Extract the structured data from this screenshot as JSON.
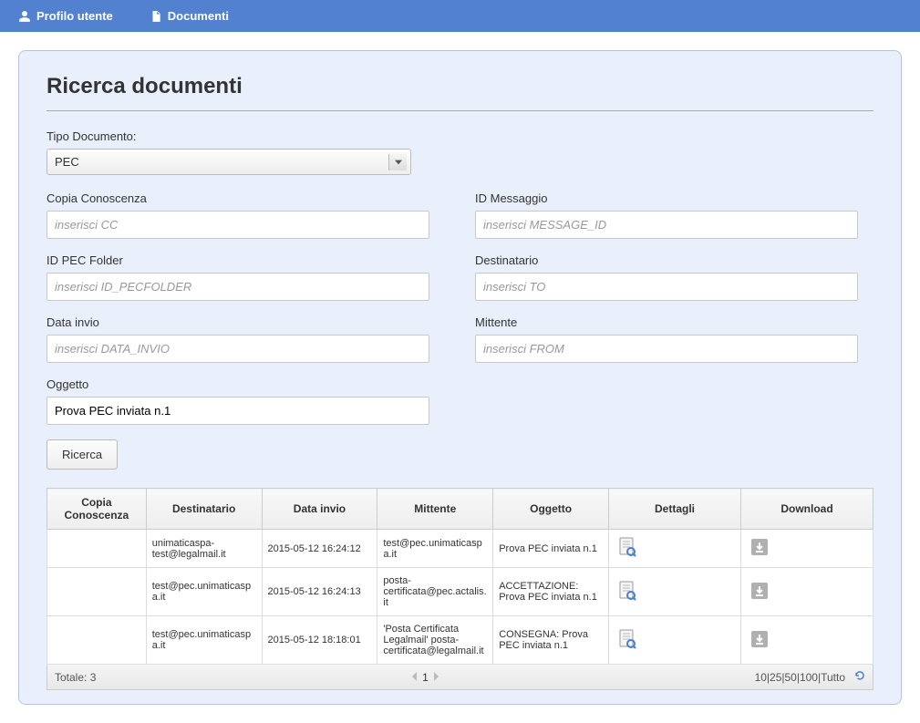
{
  "navbar": {
    "profile": "Profilo utente",
    "documents": "Documenti"
  },
  "page": {
    "title": "Ricerca documenti"
  },
  "form": {
    "tipo_label": "Tipo Documento:",
    "tipo_value": "PEC",
    "cc_label": "Copia Conoscenza",
    "cc_placeholder": "inserisci CC",
    "cc_value": "",
    "msgid_label": "ID Messaggio",
    "msgid_placeholder": "inserisci MESSAGE_ID",
    "msgid_value": "",
    "pecfolder_label": "ID PEC Folder",
    "pecfolder_placeholder": "inserisci ID_PECFOLDER",
    "pecfolder_value": "",
    "dest_label": "Destinatario",
    "dest_placeholder": "inserisci TO",
    "dest_value": "",
    "data_label": "Data invio",
    "data_placeholder": "inserisci DATA_INVIO",
    "data_value": "",
    "mitt_label": "Mittente",
    "mitt_placeholder": "inserisci FROM",
    "mitt_value": "",
    "ogg_label": "Oggetto",
    "ogg_placeholder": "",
    "ogg_value": "Prova PEC inviata n.1",
    "search_button": "Ricerca"
  },
  "table": {
    "headers": {
      "cc": "Copia Conoscenza",
      "dest": "Destinatario",
      "data": "Data invio",
      "mitt": "Mittente",
      "ogg": "Oggetto",
      "det": "Dettagli",
      "dl": "Download"
    },
    "rows": [
      {
        "cc": "",
        "dest": "unimaticaspa-test@legalmail.it",
        "data": "2015-05-12 16:24:12",
        "mitt": "test@pec.unimaticaspa.it",
        "ogg": "Prova PEC inviata n.1"
      },
      {
        "cc": "",
        "dest": "test@pec.unimaticaspa.it",
        "data": "2015-05-12 16:24:13",
        "mitt": "posta-certificata@pec.actalis.it",
        "ogg": "ACCETTAZIONE: Prova PEC inviata n.1"
      },
      {
        "cc": "",
        "dest": "test@pec.unimaticaspa.it",
        "data": "2015-05-12 18:18:01",
        "mitt": "'Posta Certificata Legalmail' posta-certificata@legalmail.it",
        "ogg": "CONSEGNA: Prova PEC inviata n.1"
      }
    ]
  },
  "footer": {
    "total": "Totale: 3",
    "page": "1",
    "pagesize": "10|25|50|100|Tutto"
  }
}
